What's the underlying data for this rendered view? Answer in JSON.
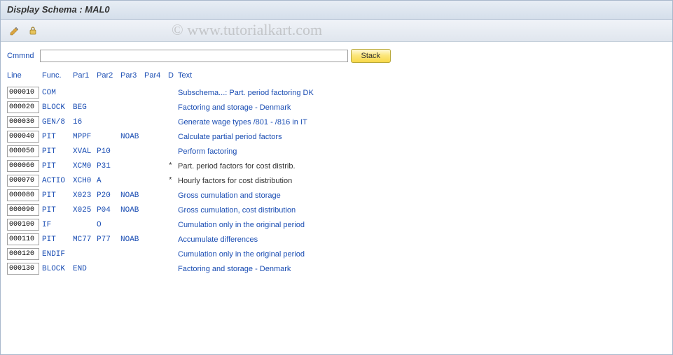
{
  "title": "Display Schema : MAL0",
  "watermark": "© www.tutorialkart.com",
  "cmd": {
    "label": "Cmmnd",
    "value": "",
    "stack": "Stack"
  },
  "headers": {
    "line": "Line",
    "func": "Func.",
    "par1": "Par1",
    "par2": "Par2",
    "par3": "Par3",
    "par4": "Par4",
    "d": "D",
    "text": "Text"
  },
  "rows": [
    {
      "line": "000010",
      "func": "COM",
      "par1": "",
      "par2": "",
      "par3": "",
      "par4": "",
      "d": "",
      "text": "Subschema...: Part. period factoring DK",
      "black": false
    },
    {
      "line": "000020",
      "func": "BLOCK",
      "par1": "BEG",
      "par2": "",
      "par3": "",
      "par4": "",
      "d": "",
      "text": "Factoring and storage - Denmark",
      "black": false
    },
    {
      "line": "000030",
      "func": "GEN/8",
      "par1": "16",
      "par2": "",
      "par3": "",
      "par4": "",
      "d": "",
      "text": "Generate wage types /801 - /816 in IT",
      "black": false
    },
    {
      "line": "000040",
      "func": "PIT",
      "par1": "MPPF",
      "par2": "",
      "par3": "NOAB",
      "par4": "",
      "d": "",
      "text": "Calculate partial period factors",
      "black": false
    },
    {
      "line": "000050",
      "func": "PIT",
      "par1": "XVAL",
      "par2": "P10",
      "par3": "",
      "par4": "",
      "d": "",
      "text": "Perform factoring",
      "black": false
    },
    {
      "line": "000060",
      "func": "PIT",
      "par1": "XCM0",
      "par2": "P31",
      "par3": "",
      "par4": "",
      "d": "*",
      "text": "Part. period factors for cost distrib.",
      "black": true
    },
    {
      "line": "000070",
      "func": "ACTIO",
      "par1": "XCH0",
      "par2": "A",
      "par3": "",
      "par4": "",
      "d": "*",
      "text": "Hourly factors for cost distribution",
      "black": true
    },
    {
      "line": "000080",
      "func": "PIT",
      "par1": "X023",
      "par2": "P20",
      "par3": "NOAB",
      "par4": "",
      "d": "",
      "text": "Gross cumulation and storage",
      "black": false
    },
    {
      "line": "000090",
      "func": "PIT",
      "par1": "X025",
      "par2": "P04",
      "par3": "NOAB",
      "par4": "",
      "d": "",
      "text": "Gross cumulation, cost distribution",
      "black": false
    },
    {
      "line": "000100",
      "func": "IF",
      "par1": "",
      "par2": "O",
      "par3": "",
      "par4": "",
      "d": "",
      "text": "Cumulation only in the original period",
      "black": false
    },
    {
      "line": "000110",
      "func": "PIT",
      "par1": "MC77",
      "par2": "P77",
      "par3": "NOAB",
      "par4": "",
      "d": "",
      "text": "Accumulate differences",
      "black": false
    },
    {
      "line": "000120",
      "func": "ENDIF",
      "par1": "",
      "par2": "",
      "par3": "",
      "par4": "",
      "d": "",
      "text": "Cumulation only in the original period",
      "black": false
    },
    {
      "line": "000130",
      "func": "BLOCK",
      "par1": "END",
      "par2": "",
      "par3": "",
      "par4": "",
      "d": "",
      "text": "Factoring and storage - Denmark",
      "black": false
    }
  ]
}
